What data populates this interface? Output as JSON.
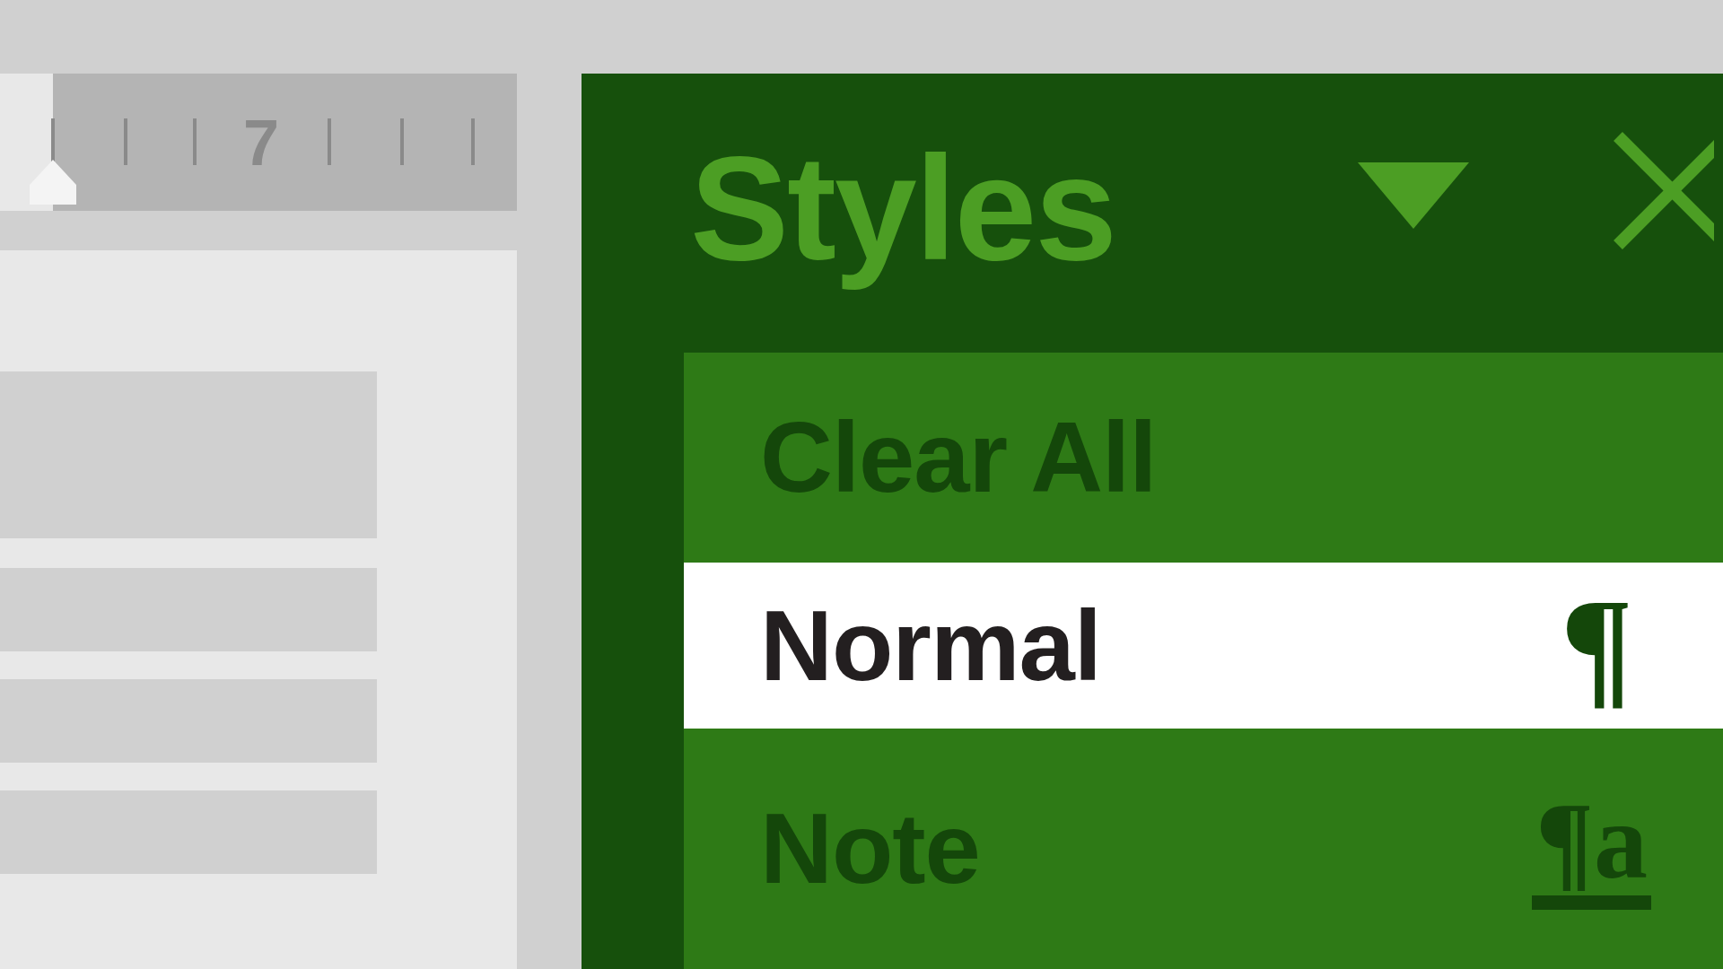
{
  "ruler": {
    "label": "7"
  },
  "styles_pane": {
    "title": "Styles",
    "items": [
      {
        "label": "Clear All",
        "selected": false
      },
      {
        "label": "Normal",
        "selected": true,
        "glyph": "¶"
      },
      {
        "label": "Note",
        "selected": false,
        "glyph": "¶a",
        "kind": "linked"
      }
    ]
  }
}
